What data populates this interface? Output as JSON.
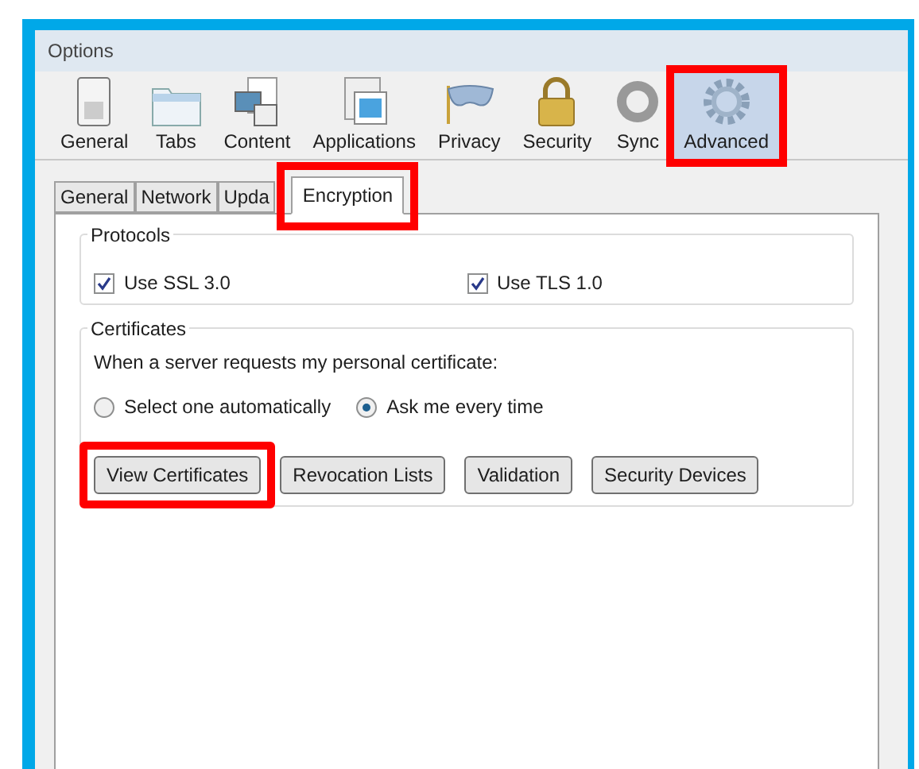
{
  "window": {
    "title": "Options"
  },
  "toolbar": [
    {
      "label": "General",
      "selected": false,
      "highlighted": false
    },
    {
      "label": "Tabs",
      "selected": false,
      "highlighted": false
    },
    {
      "label": "Content",
      "selected": false,
      "highlighted": false
    },
    {
      "label": "Applications",
      "selected": false,
      "highlighted": false
    },
    {
      "label": "Privacy",
      "selected": false,
      "highlighted": false
    },
    {
      "label": "Security",
      "selected": false,
      "highlighted": false
    },
    {
      "label": "Sync",
      "selected": false,
      "highlighted": false
    },
    {
      "label": "Advanced",
      "selected": true,
      "highlighted": true
    }
  ],
  "tabs": [
    {
      "label": "General",
      "selected": false,
      "highlighted": false
    },
    {
      "label": "Network",
      "selected": false,
      "highlighted": false
    },
    {
      "label": "Upda",
      "selected": false,
      "highlighted": false
    },
    {
      "label": "Encryption",
      "selected": true,
      "highlighted": true
    }
  ],
  "protocols": {
    "title": "Protocols",
    "options": [
      {
        "label": "Use SSL 3.0",
        "checked": true
      },
      {
        "label": "Use TLS 1.0",
        "checked": true
      }
    ]
  },
  "certificates": {
    "title": "Certificates",
    "prompt": "When a server requests my personal certificate:",
    "choices": [
      {
        "label": "Select one automatically",
        "selected": false
      },
      {
        "label": "Ask me every time",
        "selected": true
      }
    ],
    "buttons": [
      {
        "label": "View Certificates",
        "highlighted": true
      },
      {
        "label": "Revocation Lists",
        "highlighted": false
      },
      {
        "label": "Validation",
        "highlighted": false
      },
      {
        "label": "Security Devices",
        "highlighted": false
      }
    ]
  }
}
